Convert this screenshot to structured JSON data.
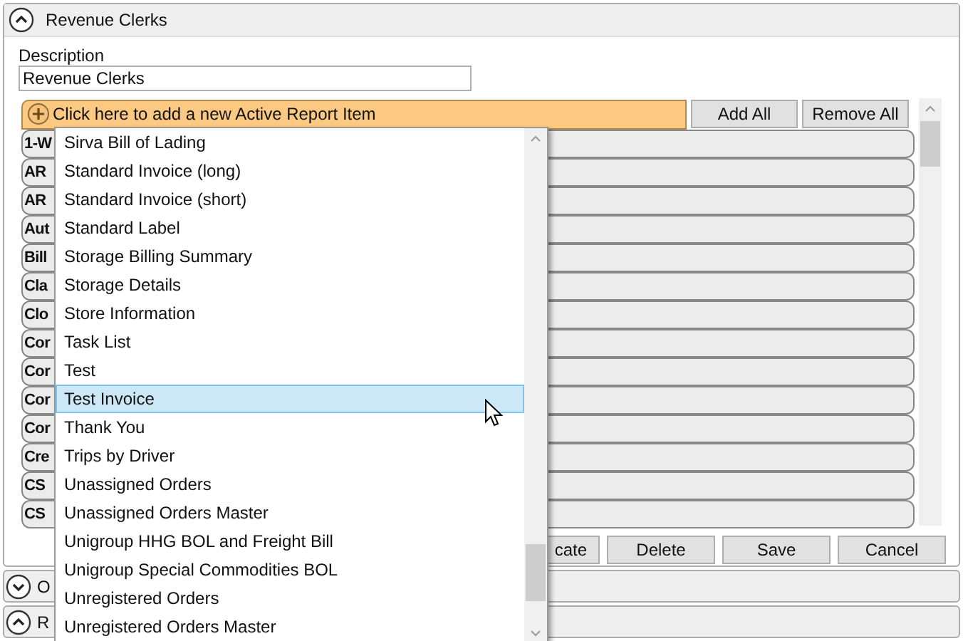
{
  "section": {
    "title": "Revenue Clerks",
    "expanded": true,
    "description_label": "Description",
    "description_value": "Revenue Clerks",
    "add_bar": "Click here to add a new Active Report Item",
    "toolbar_buttons": [
      "Add All",
      "Remove All"
    ],
    "report_items": [
      "1-W",
      "AR",
      "AR",
      "Aut",
      "Bill",
      "Cla",
      "Clo",
      "Cor",
      "Cor",
      "Cor",
      "Cor",
      "Cre",
      "CS",
      "CS"
    ],
    "action_buttons": [
      "cate",
      "Delete",
      "Save",
      "Cancel"
    ]
  },
  "other_sections": [
    {
      "title": "O",
      "expanded": false
    },
    {
      "title": "R",
      "expanded": true
    }
  ],
  "dropdown": {
    "items": [
      {
        "label": "Sirva Bill of Lading",
        "selected": false
      },
      {
        "label": "Standard Invoice (long)",
        "selected": false
      },
      {
        "label": "Standard Invoice (short)",
        "selected": false
      },
      {
        "label": "Standard Label",
        "selected": false
      },
      {
        "label": "Storage Billing Summary",
        "selected": false
      },
      {
        "label": "Storage Details",
        "selected": false
      },
      {
        "label": "Store Information",
        "selected": false
      },
      {
        "label": "Task List",
        "selected": false
      },
      {
        "label": "Test",
        "selected": false
      },
      {
        "label": "Test Invoice",
        "selected": true
      },
      {
        "label": "Thank You",
        "selected": false
      },
      {
        "label": "Trips by Driver",
        "selected": false
      },
      {
        "label": "Unassigned Orders",
        "selected": false
      },
      {
        "label": "Unassigned Orders Master",
        "selected": false
      },
      {
        "label": "Unigroup HHG BOL and Freight Bill",
        "selected": false
      },
      {
        "label": "Unigroup Special Commodities BOL",
        "selected": false
      },
      {
        "label": "Unregistered Orders",
        "selected": false
      },
      {
        "label": "Unregistered Orders Master",
        "selected": false
      }
    ]
  }
}
